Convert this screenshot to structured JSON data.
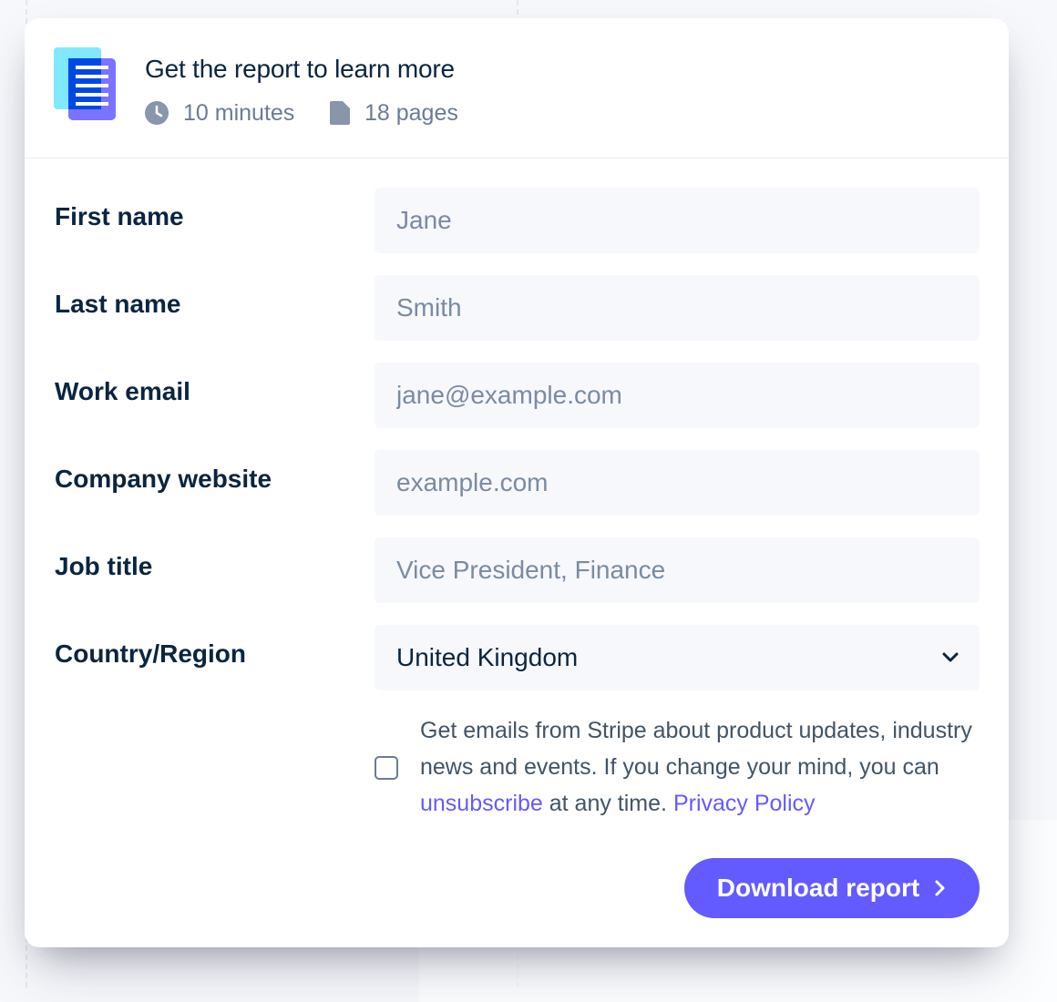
{
  "header": {
    "title": "Get the report to learn more",
    "read_time": "10 minutes",
    "page_count": "18 pages",
    "icons": {
      "document": "document-icon",
      "clock": "clock-icon",
      "page": "page-icon"
    }
  },
  "form": {
    "fields": [
      {
        "label": "First name",
        "placeholder": "Jane",
        "value": ""
      },
      {
        "label": "Last name",
        "placeholder": "Smith",
        "value": ""
      },
      {
        "label": "Work email",
        "placeholder": "jane@example.com",
        "value": ""
      },
      {
        "label": "Company website",
        "placeholder": "example.com",
        "value": ""
      },
      {
        "label": "Job title",
        "placeholder": "Vice President, Finance",
        "value": ""
      }
    ],
    "country": {
      "label": "Country/Region",
      "selected": "United Kingdom"
    },
    "consent": {
      "checked": false,
      "text_before": "Get emails from Stripe about product updates, industry news and events. If you change your mind, you can ",
      "unsubscribe_label": "unsubscribe",
      "text_middle": " at any time. ",
      "privacy_label": "Privacy Policy"
    },
    "submit_label": "Download report"
  },
  "colors": {
    "accent": "#635bff",
    "heading": "#0a2540",
    "muted": "#6b7c93",
    "field_bg": "#f6f8fb"
  }
}
